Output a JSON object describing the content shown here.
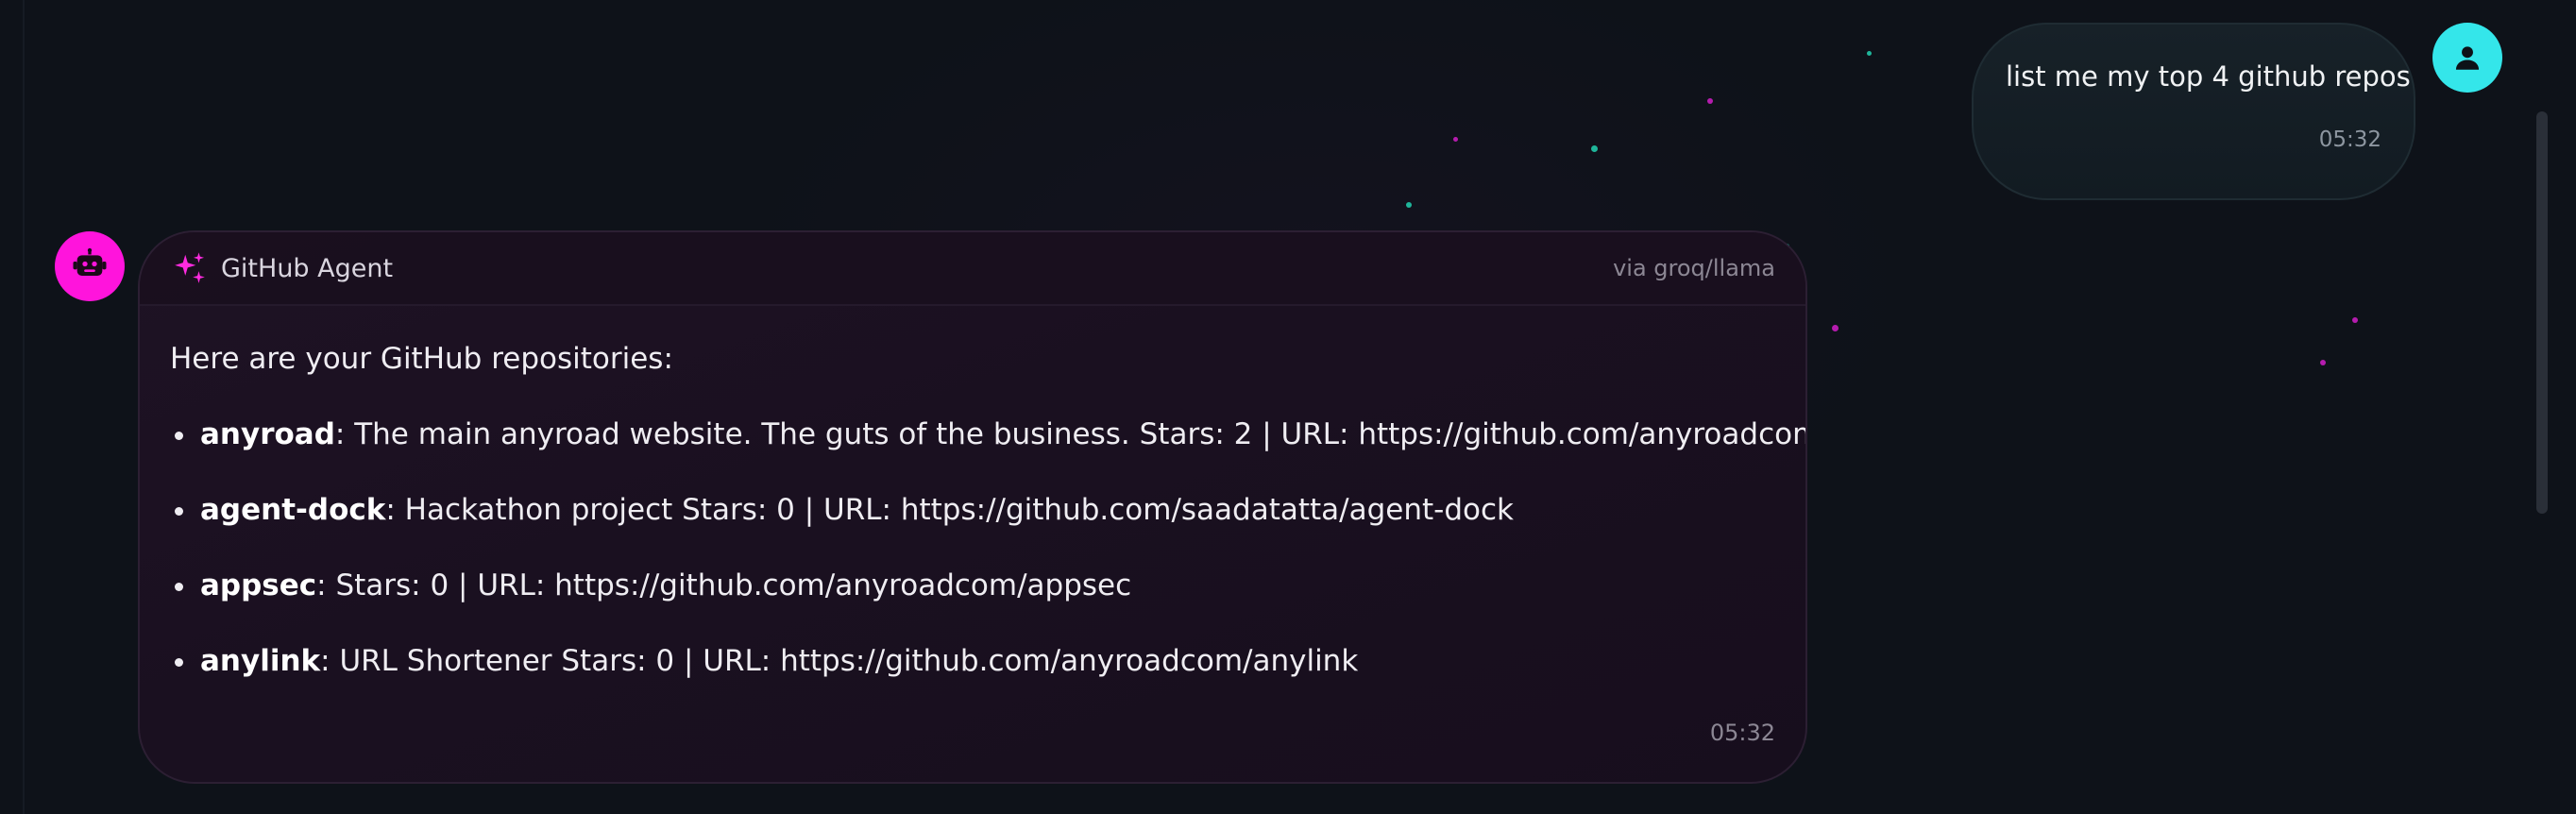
{
  "user_message": {
    "text": "list me my top 4 github repos",
    "time": "05:32",
    "avatar_icon": "user-icon",
    "avatar_color": "#34e6ea"
  },
  "agent_message": {
    "agent_name": "GitHub Agent",
    "via": "via groq/llama",
    "intro": "Here are your GitHub repositories:",
    "repos": [
      {
        "name": "anyroad",
        "description": ": The main anyroad website. The guts of the business. Stars: 2 | URL: https://github.com/anyroadcom/anyroad"
      },
      {
        "name": "agent-dock",
        "description": ": Hackathon project Stars: 0 | URL: https://github.com/saadatatta/agent-dock"
      },
      {
        "name": "appsec",
        "description": ": Stars: 0 | URL: https://github.com/anyroadcom/appsec"
      },
      {
        "name": "anylink",
        "description": ": URL Shortener Stars: 0 | URL: https://github.com/anyroadcom/anylink"
      }
    ],
    "time": "05:32",
    "avatar_icon": "robot-icon",
    "header_icon": "sparkles-icon",
    "avatar_color": "#ff14dc"
  }
}
